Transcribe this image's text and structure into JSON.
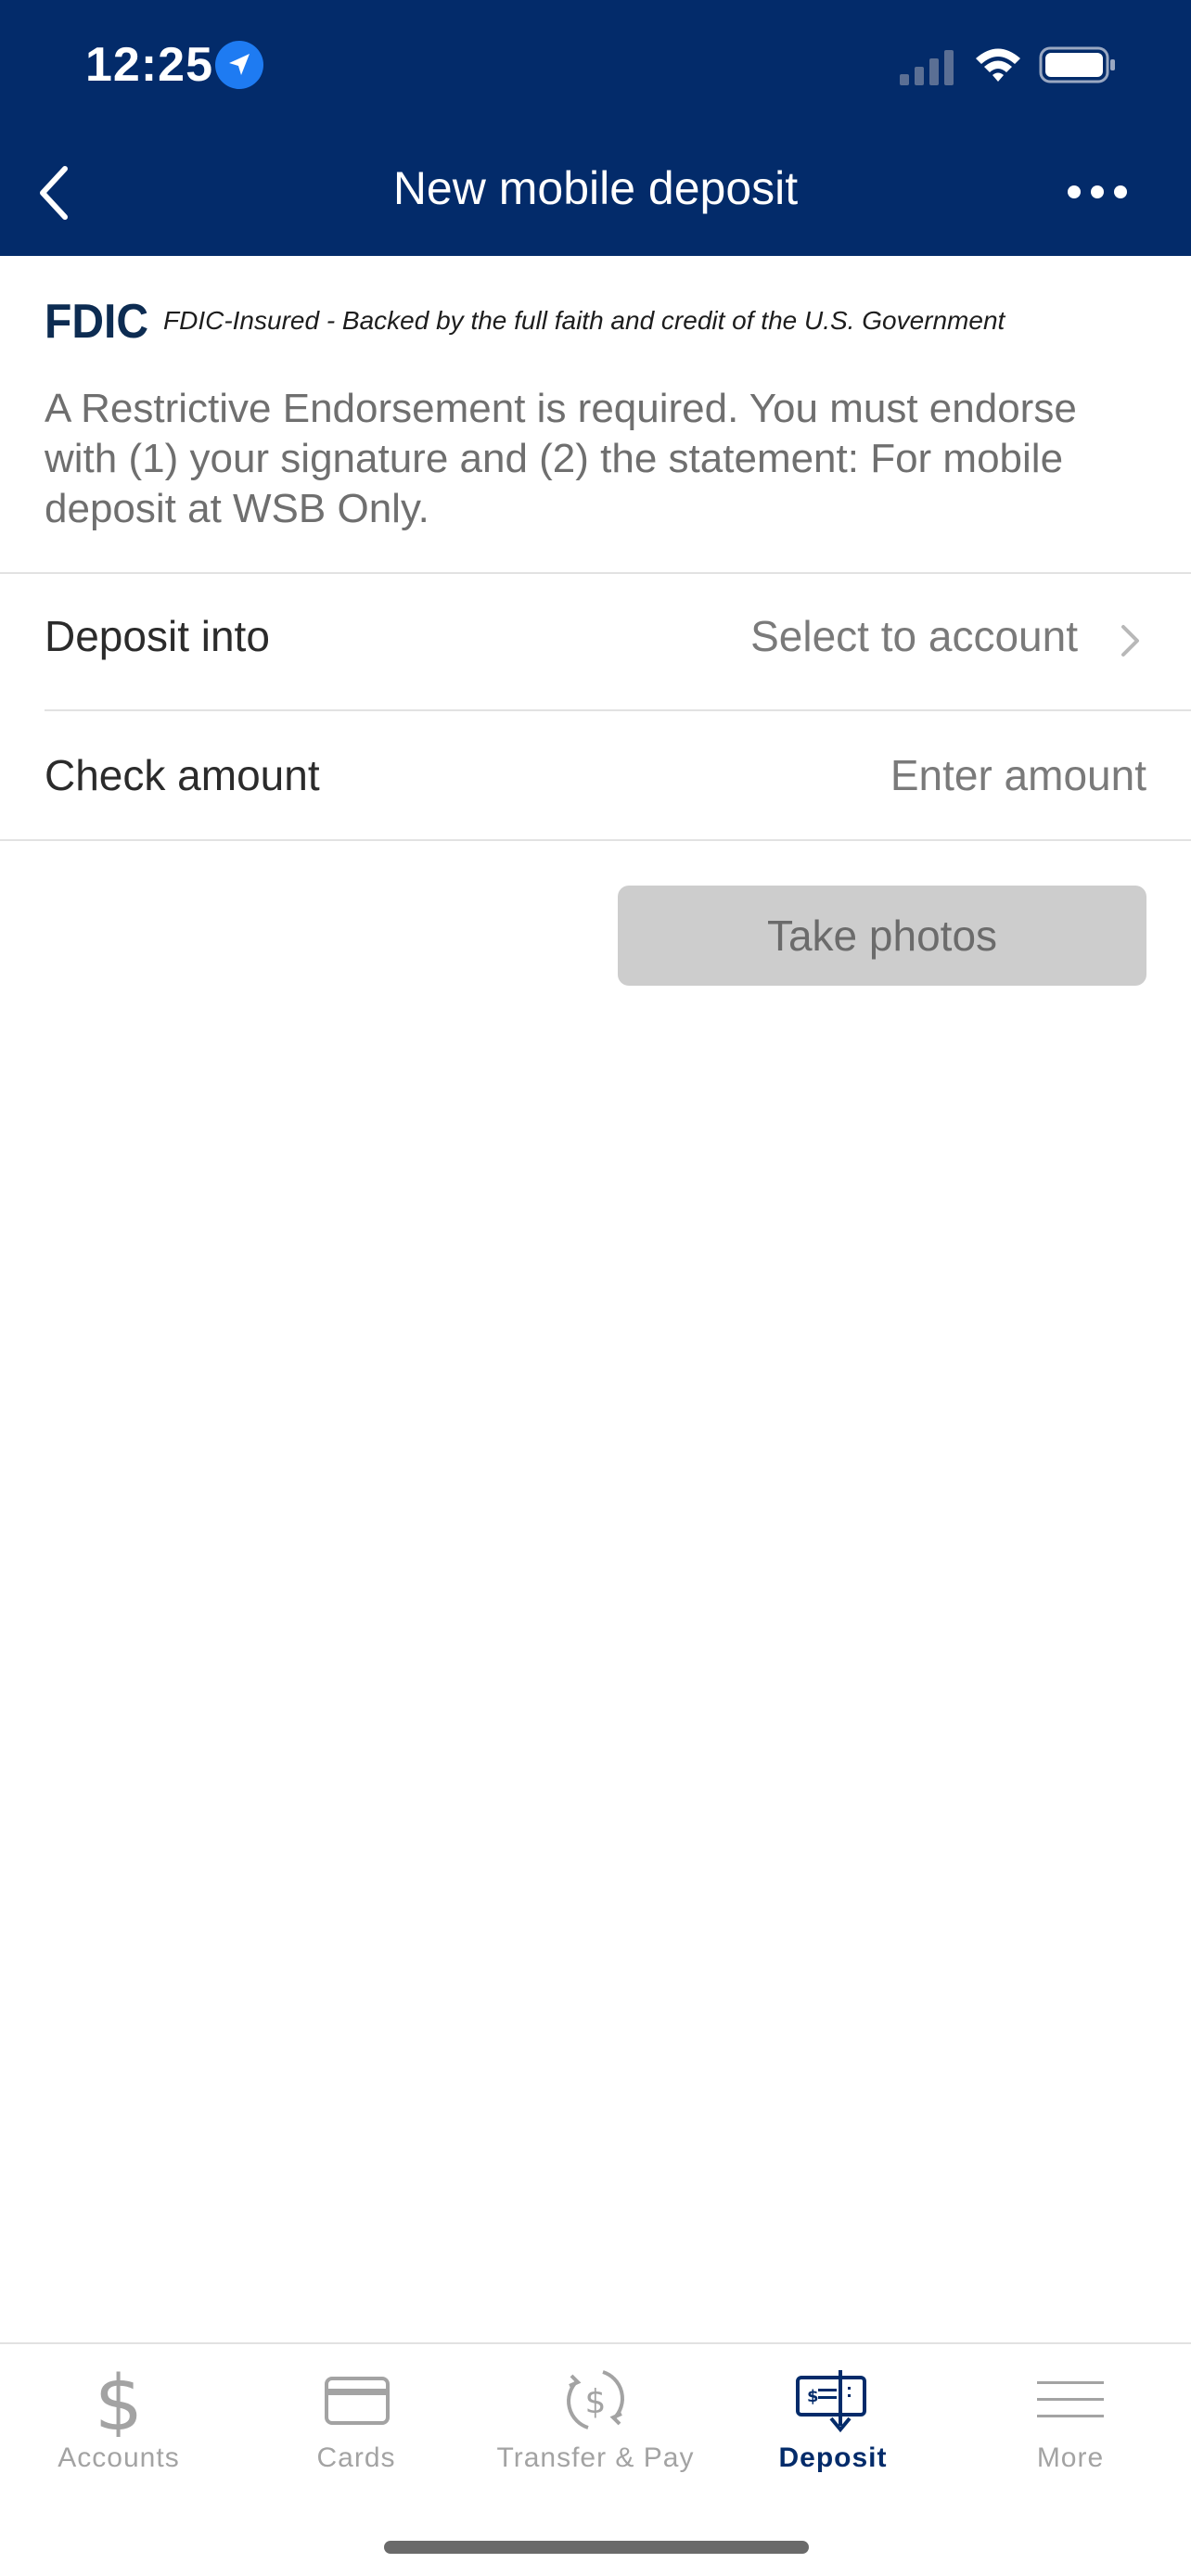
{
  "status_bar": {
    "time": "12:25"
  },
  "header": {
    "title": "New mobile deposit"
  },
  "fdic": {
    "logo_text": "FDIC",
    "notice": "FDIC-Insured - Backed by the full faith and credit of the U.S. Government"
  },
  "endorsement_notice": "A Restrictive Endorsement is required. You must endorse with (1) your signature and (2) the statement: For mobile deposit at WSB Only.",
  "form": {
    "deposit_into": {
      "label": "Deposit into",
      "value": "Select to account"
    },
    "check_amount": {
      "label": "Check amount",
      "placeholder": "Enter amount"
    }
  },
  "take_photos_label": "Take photos",
  "tabs": [
    {
      "label": "Accounts",
      "icon": "dollar-icon",
      "active": false
    },
    {
      "label": "Cards",
      "icon": "card-icon",
      "active": false
    },
    {
      "label": "Transfer & Pay",
      "icon": "transfer-icon",
      "active": false
    },
    {
      "label": "Deposit",
      "icon": "deposit-check-icon",
      "active": true
    },
    {
      "label": "More",
      "icon": "menu-icon",
      "active": false
    }
  ],
  "colors": {
    "header_bg": "#032b6a",
    "active_tab": "#032b6a",
    "inactive_tab": "#a3a3a3",
    "disabled_button": "#cdcdcd"
  }
}
